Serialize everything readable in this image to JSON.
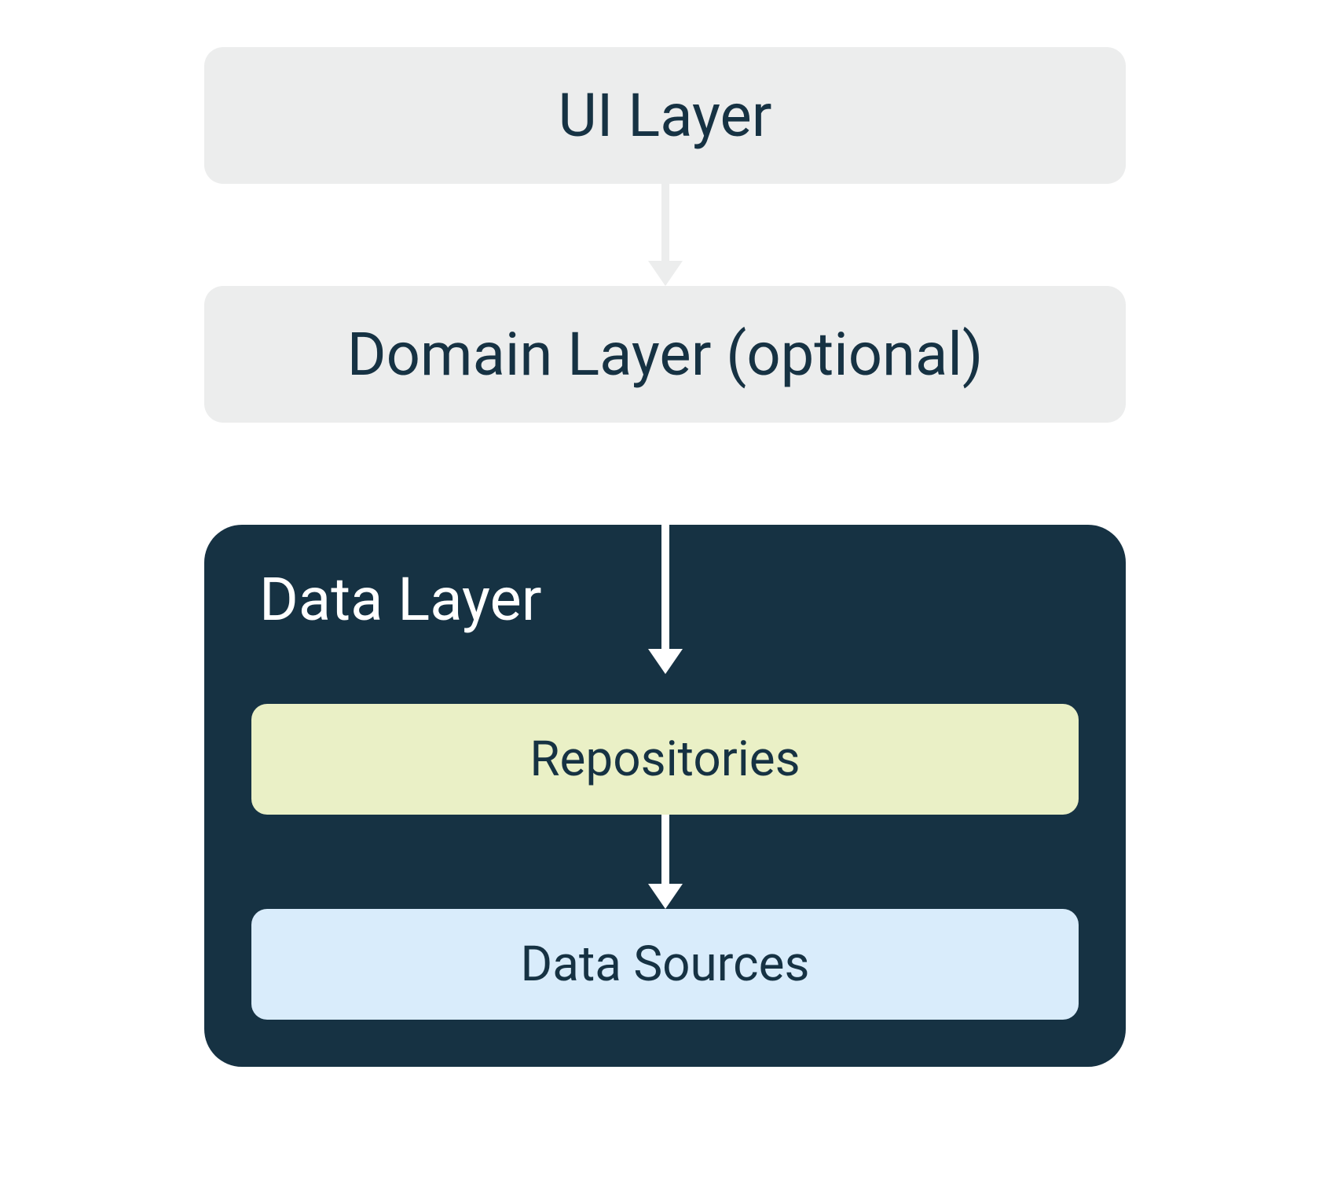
{
  "layers": {
    "ui": "UI Layer",
    "domain": "Domain Layer (optional)",
    "data": {
      "title": "Data Layer",
      "repositories": "Repositories",
      "dataSources": "Data Sources"
    }
  },
  "colors": {
    "lightGray": "#eceded",
    "darkBlue": "#163243",
    "lightGreen": "#eaf0c6",
    "lightBlue": "#d9ecfb",
    "white": "#ffffff"
  }
}
